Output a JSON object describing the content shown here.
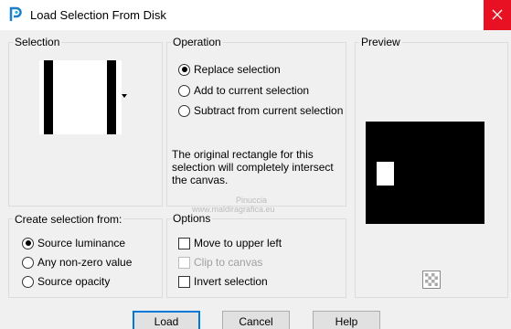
{
  "window": {
    "title": "Load Selection From Disk"
  },
  "selection_group": {
    "title": "Selection"
  },
  "operation_group": {
    "title": "Operation",
    "options": [
      {
        "label": "Replace selection",
        "checked": true
      },
      {
        "label": "Add to current selection",
        "checked": false
      },
      {
        "label": "Subtract from current selection",
        "checked": false
      }
    ],
    "note": "The original rectangle for this selection will completely intersect the canvas."
  },
  "preview_group": {
    "title": "Preview"
  },
  "create_group": {
    "title": "Create selection from:",
    "options": [
      {
        "label": "Source luminance",
        "checked": true
      },
      {
        "label": "Any non-zero value",
        "checked": false
      },
      {
        "label": "Source opacity",
        "checked": false
      }
    ]
  },
  "options_group": {
    "title": "Options",
    "items": [
      {
        "label": "Move to upper left",
        "checked": false,
        "enabled": true
      },
      {
        "label": "Clip to canvas",
        "checked": false,
        "enabled": false
      },
      {
        "label": "Invert selection",
        "checked": false,
        "enabled": true
      }
    ]
  },
  "watermark": {
    "line1": "Pinuccia",
    "line2": "www.maldiragrafica.eu"
  },
  "buttons": {
    "load": "Load",
    "cancel": "Cancel",
    "help": "Help"
  },
  "icons": {
    "app": "app-icon",
    "close": "close-icon",
    "dropdown": "dropdown-arrow-icon",
    "transparency": "checkerboard-icon"
  },
  "colors": {
    "close_bg": "#e81123",
    "default_button_border": "#0078d7"
  }
}
